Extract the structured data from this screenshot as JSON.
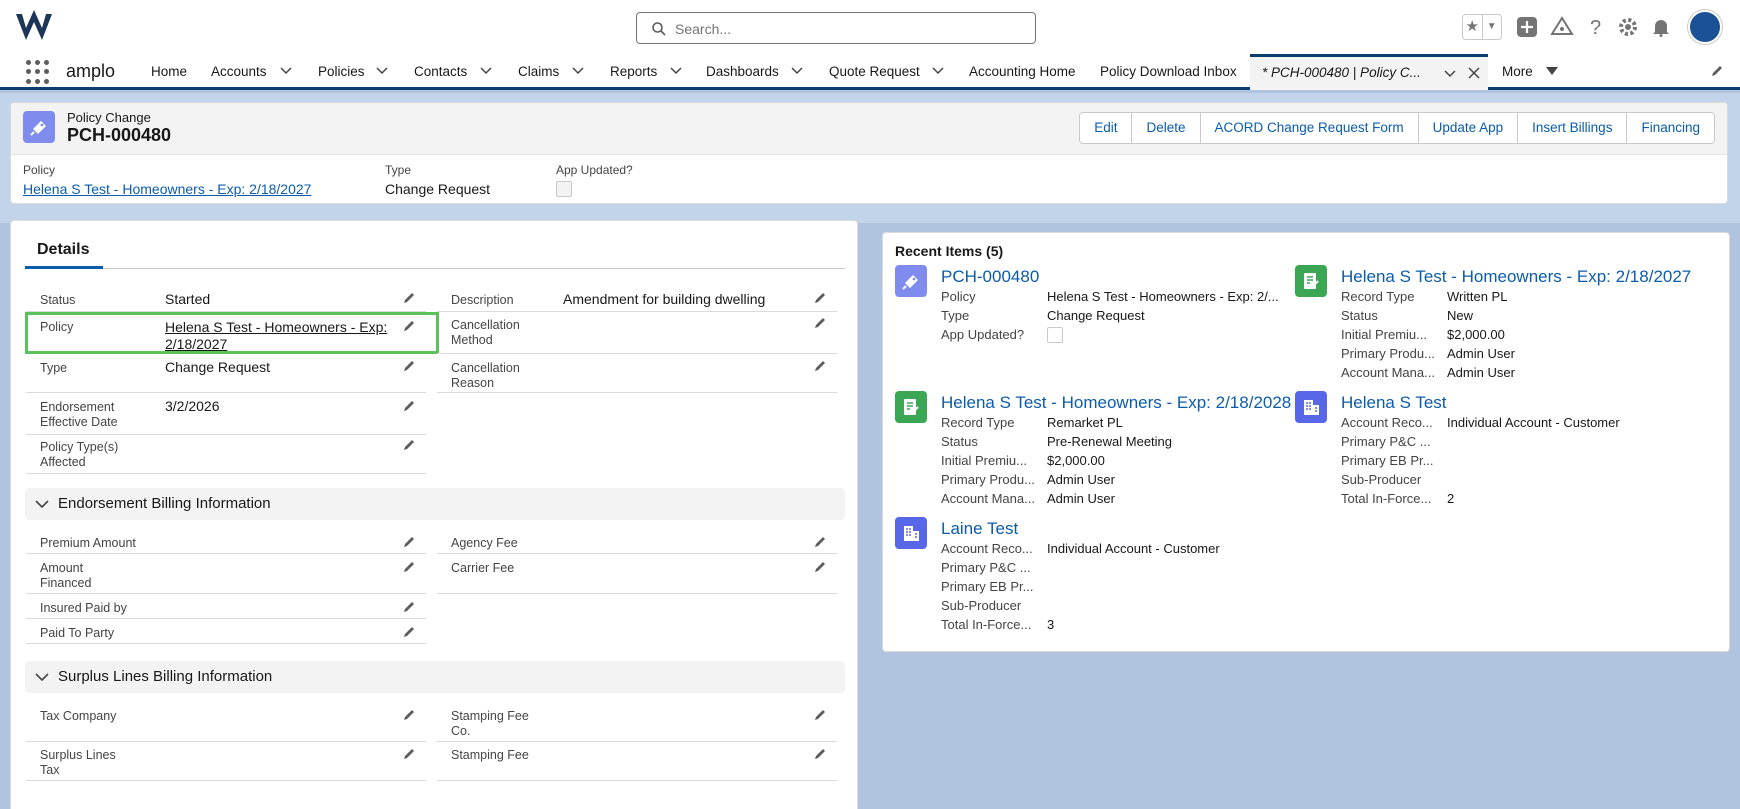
{
  "header": {
    "app_name": "amplo",
    "search_placeholder": "Search..."
  },
  "nav": {
    "items": [
      {
        "label": "Home"
      },
      {
        "label": "Accounts"
      },
      {
        "label": "Policies"
      },
      {
        "label": "Contacts"
      },
      {
        "label": "Claims"
      },
      {
        "label": "Reports"
      },
      {
        "label": "Dashboards"
      },
      {
        "label": "Quote Request"
      },
      {
        "label": "Accounting Home"
      },
      {
        "label": "Policy Download Inbox"
      }
    ],
    "active_tab": "* PCH-000480 | Policy C...",
    "more": "More"
  },
  "record": {
    "entity": "Policy Change",
    "title": "PCH-000480",
    "actions": [
      "Edit",
      "Delete",
      "ACORD Change Request Form",
      "Update App",
      "Insert Billings",
      "Financing"
    ],
    "highlights": {
      "policy_label": "Policy",
      "policy_value": "Helena S Test - Homeowners - Exp: 2/18/2027",
      "type_label": "Type",
      "type_value": "Change Request",
      "app_updated_label": "App Updated?"
    }
  },
  "details": {
    "tab": "Details",
    "fields_left": [
      {
        "label": "Status",
        "value": "Started"
      },
      {
        "label": "Policy",
        "value": "Helena S Test - Homeowners - Exp: 2/18/2027"
      },
      {
        "label": "Type",
        "value": "Change Request"
      },
      {
        "label": "Endorsement Effective Date",
        "value": "3/2/2026"
      },
      {
        "label": "Policy Type(s) Affected",
        "value": ""
      }
    ],
    "fields_right": [
      {
        "label": "Description",
        "value": "Amendment for building dwelling"
      },
      {
        "label": "Cancellation Method",
        "value": ""
      },
      {
        "label": "Cancellation Reason",
        "value": ""
      }
    ],
    "section_billing": "Endorsement Billing Information",
    "billing_left": [
      "Premium Amount",
      "Amount Financed",
      "Insured Paid by",
      "Paid To Party"
    ],
    "billing_right": [
      "Agency Fee",
      "Carrier Fee"
    ],
    "section_surplus": "Surplus Lines Billing Information",
    "surplus_left": [
      "Tax Company",
      "Surplus Lines Tax"
    ],
    "surplus_right": [
      "Stamping Fee Co.",
      "Stamping Fee"
    ]
  },
  "recent": {
    "title": "Recent Items (5)",
    "items": [
      {
        "title": "PCH-000480",
        "icon": "policy-change-icon",
        "color": "#7f8ced",
        "rows": [
          [
            "Policy",
            "Helena S Test - Homeowners - Exp: 2/..."
          ],
          [
            "Type",
            "Change Request"
          ],
          [
            "App Updated?",
            ""
          ]
        ]
      },
      {
        "title": "Helena S Test - Homeowners - Exp: 2/18/2027",
        "icon": "policy-icon",
        "color": "#3ba755",
        "rows": [
          [
            "Record Type",
            "Written PL"
          ],
          [
            "Status",
            "New"
          ],
          [
            "Initial Premiu...",
            "$2,000.00"
          ],
          [
            "Primary Produ...",
            "Admin User"
          ],
          [
            "Account Mana...",
            "Admin User"
          ]
        ]
      },
      {
        "title": "Helena S Test - Homeowners - Exp: 2/18/2028",
        "icon": "policy-icon",
        "color": "#3ba755",
        "rows": [
          [
            "Record Type",
            "Remarket PL"
          ],
          [
            "Status",
            "Pre-Renewal Meeting"
          ],
          [
            "Initial Premiu...",
            "$2,000.00"
          ],
          [
            "Primary Produ...",
            "Admin User"
          ],
          [
            "Account Mana...",
            "Admin User"
          ]
        ]
      },
      {
        "title": "Helena S Test",
        "icon": "account-icon",
        "color": "#5867e8",
        "rows": [
          [
            "Account Reco...",
            "Individual Account - Customer"
          ],
          [
            "Primary P&C ...",
            ""
          ],
          [
            "Primary EB Pr...",
            ""
          ],
          [
            "Sub-Producer",
            ""
          ],
          [
            "Total In-Force...",
            "2"
          ]
        ]
      },
      {
        "title": "Laine Test",
        "icon": "account-icon",
        "color": "#5867e8",
        "rows": [
          [
            "Account Reco...",
            "Individual Account - Customer"
          ],
          [
            "Primary P&C ...",
            ""
          ],
          [
            "Primary EB Pr...",
            ""
          ],
          [
            "Sub-Producer",
            ""
          ],
          [
            "Total In-Force...",
            "3"
          ]
        ]
      }
    ]
  },
  "colors": {
    "brand_nav": "#0b3e6d",
    "link": "#0b5cab",
    "highlight_box": "#5cc35c"
  }
}
